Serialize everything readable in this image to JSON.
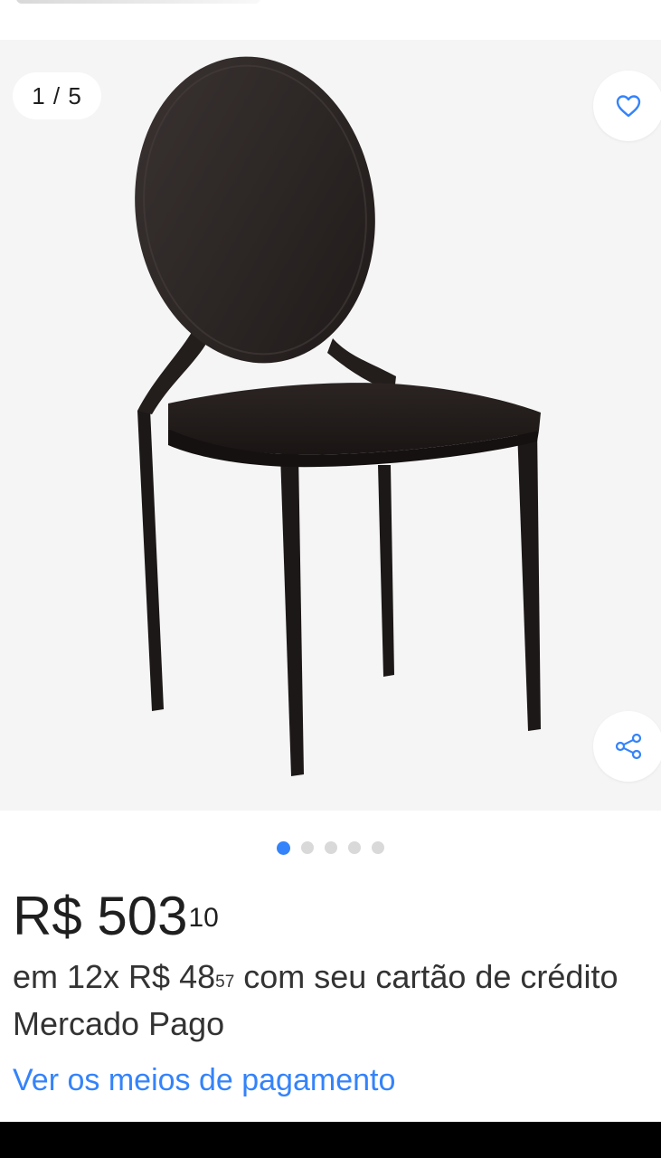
{
  "gallery": {
    "counter": "1 / 5",
    "image_alt": "Cadeira",
    "dots_total": 5,
    "active_dot": 1
  },
  "icons": {
    "favorite": "heart-icon",
    "share": "share-icon"
  },
  "price": {
    "main": "R$ 503",
    "cents": "10"
  },
  "installments": {
    "prefix": "em 12x R$ 48",
    "cents": "57",
    "suffix": " com seu cartão de crédito Mercado Pago"
  },
  "payment_link": "Ver os meios de pagamento",
  "colors": {
    "accent": "#3483fa",
    "gallery_bg": "#f5f5f5",
    "text": "#1f1f1f"
  }
}
